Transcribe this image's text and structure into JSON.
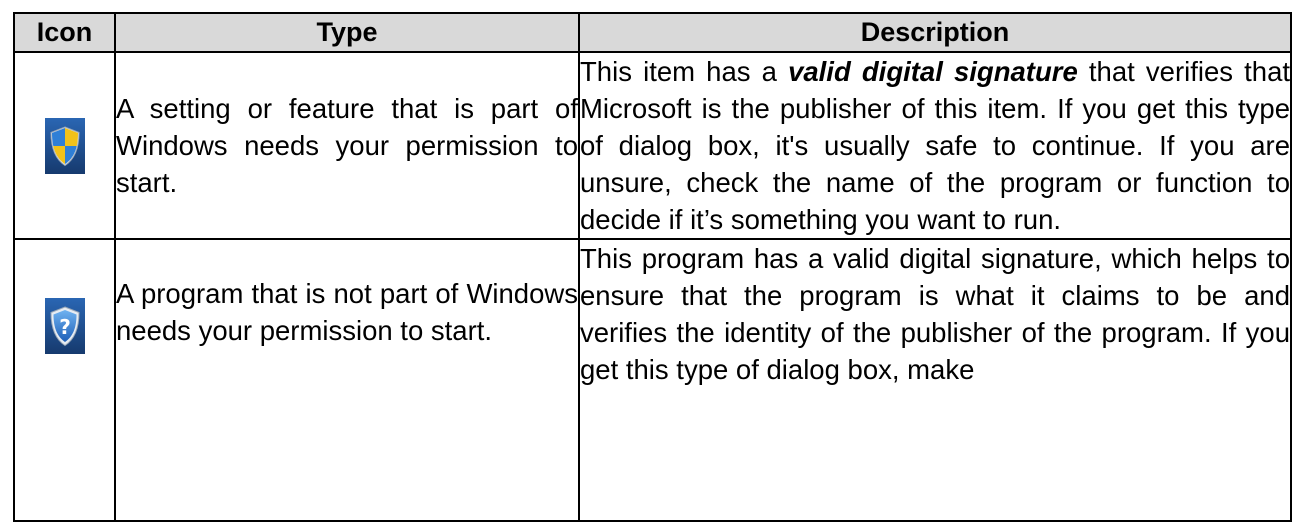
{
  "table": {
    "headers": {
      "icon": "Icon",
      "type": "Type",
      "description": "Description"
    },
    "rows": [
      {
        "icon": "windows-uac-shield-icon",
        "type": "A setting or feature that is part of Windows needs your permission to start.",
        "description_pre": "This item has a ",
        "description_emphasis": "valid digital signature",
        "description_post": " that verifies that Microsoft is the publisher of this item. If you get this type of dialog box, it's usually safe to continue. If you are unsure, check the name of the program or function to decide if it’s something you want to run."
      },
      {
        "icon": "question-shield-icon",
        "type": "A program that is not part of Windows needs your permission to start.",
        "description": "This program has a valid digital signature, which helps to ensure that the program is what it claims to be and verifies the identity of the publisher of the program. If you get this type of dialog box, make"
      }
    ]
  },
  "colors": {
    "header_bg": "#d9d9d9",
    "border": "#000000",
    "icon_bg_blue": "#1f4f91",
    "shield_yellow": "#f2c21a",
    "shield_blue": "#2f7fd6"
  }
}
